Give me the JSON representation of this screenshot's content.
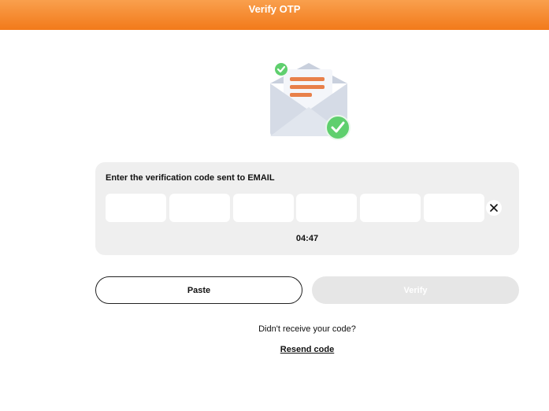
{
  "header": {
    "title": "Verify OTP"
  },
  "illustration": {
    "icon": "envelope-check-icon"
  },
  "verification": {
    "prompt": "Enter the verification code sent to EMAIL",
    "otp_digits": [
      "",
      "",
      "",
      "",
      "",
      ""
    ],
    "timer": "04:47",
    "clear_icon": "close-icon"
  },
  "actions": {
    "paste_label": "Paste",
    "verify_label": "Verify"
  },
  "footer": {
    "no_code_text": "Didn't receive your code?",
    "resend_label": "Resend code"
  },
  "colors": {
    "header_start": "#f9a04d",
    "header_end": "#f27a1a",
    "card_bg": "#efefef",
    "verify_disabled_bg": "#e6e6e6",
    "envelope": "#d5dbe6",
    "letter_lines": "#e8804a",
    "check_green": "#5fcf6e"
  }
}
